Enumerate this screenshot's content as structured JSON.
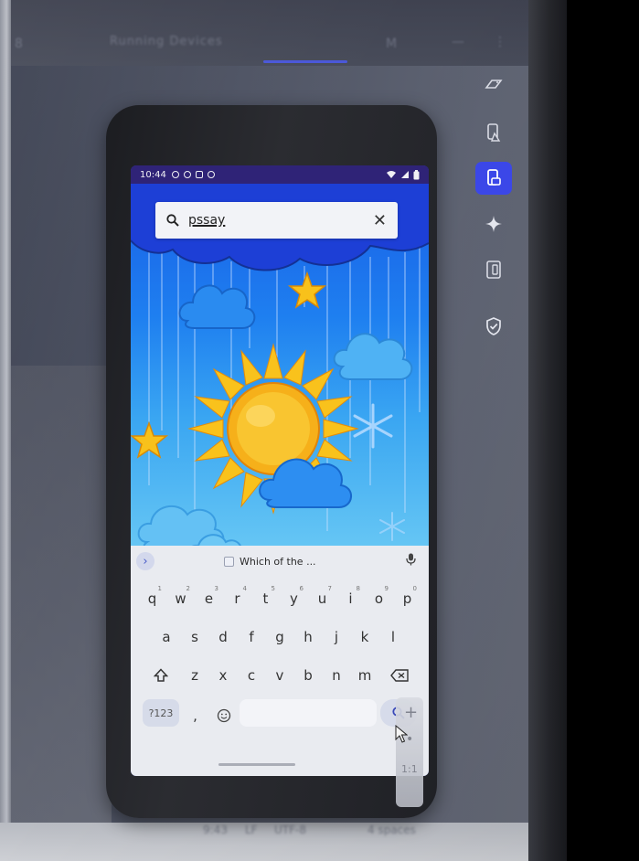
{
  "ide": {
    "tab_label": "Running Devices",
    "top_glyphs": [
      "8",
      "M",
      "—",
      "⋮"
    ],
    "status_bar_items": [
      "9:43",
      "LF",
      "UTF-8",
      "4 spaces"
    ]
  },
  "side_toolbar": {
    "items": [
      "emulator",
      "device-lab",
      "device-manager",
      "gemini",
      "device-mirroring",
      "security"
    ],
    "active": "device-manager"
  },
  "phone": {
    "status_bar": {
      "time": "10:44"
    },
    "search": {
      "query": "pssay"
    },
    "keyboard": {
      "suggestion_chip": "Which of the ...",
      "rows": [
        [
          {
            "key": "q",
            "sup": "1"
          },
          {
            "key": "w",
            "sup": "2"
          },
          {
            "key": "e",
            "sup": "3"
          },
          {
            "key": "r",
            "sup": "4"
          },
          {
            "key": "t",
            "sup": "5"
          },
          {
            "key": "y",
            "sup": "6"
          },
          {
            "key": "u",
            "sup": "7"
          },
          {
            "key": "i",
            "sup": "8"
          },
          {
            "key": "o",
            "sup": "9"
          },
          {
            "key": "p",
            "sup": "0"
          }
        ],
        [
          {
            "key": "a"
          },
          {
            "key": "s"
          },
          {
            "key": "d"
          },
          {
            "key": "f"
          },
          {
            "key": "g"
          },
          {
            "key": "h"
          },
          {
            "key": "j"
          },
          {
            "key": "k"
          },
          {
            "key": "l"
          }
        ],
        [
          {
            "key": "z"
          },
          {
            "key": "x"
          },
          {
            "key": "c"
          },
          {
            "key": "v"
          },
          {
            "key": "b"
          },
          {
            "key": "n"
          },
          {
            "key": "m"
          }
        ]
      ],
      "symbols_label": "?123",
      "comma_label": ","
    }
  },
  "emulator_controls": [
    "+",
    "•",
    "1:1"
  ],
  "colors": {
    "accent": "#3b47e8",
    "phone_status_bar": "#2f2377",
    "sky_top": "#1a5fe6",
    "sky_bottom": "#6bcaf4",
    "sun": "#f7b21a"
  }
}
